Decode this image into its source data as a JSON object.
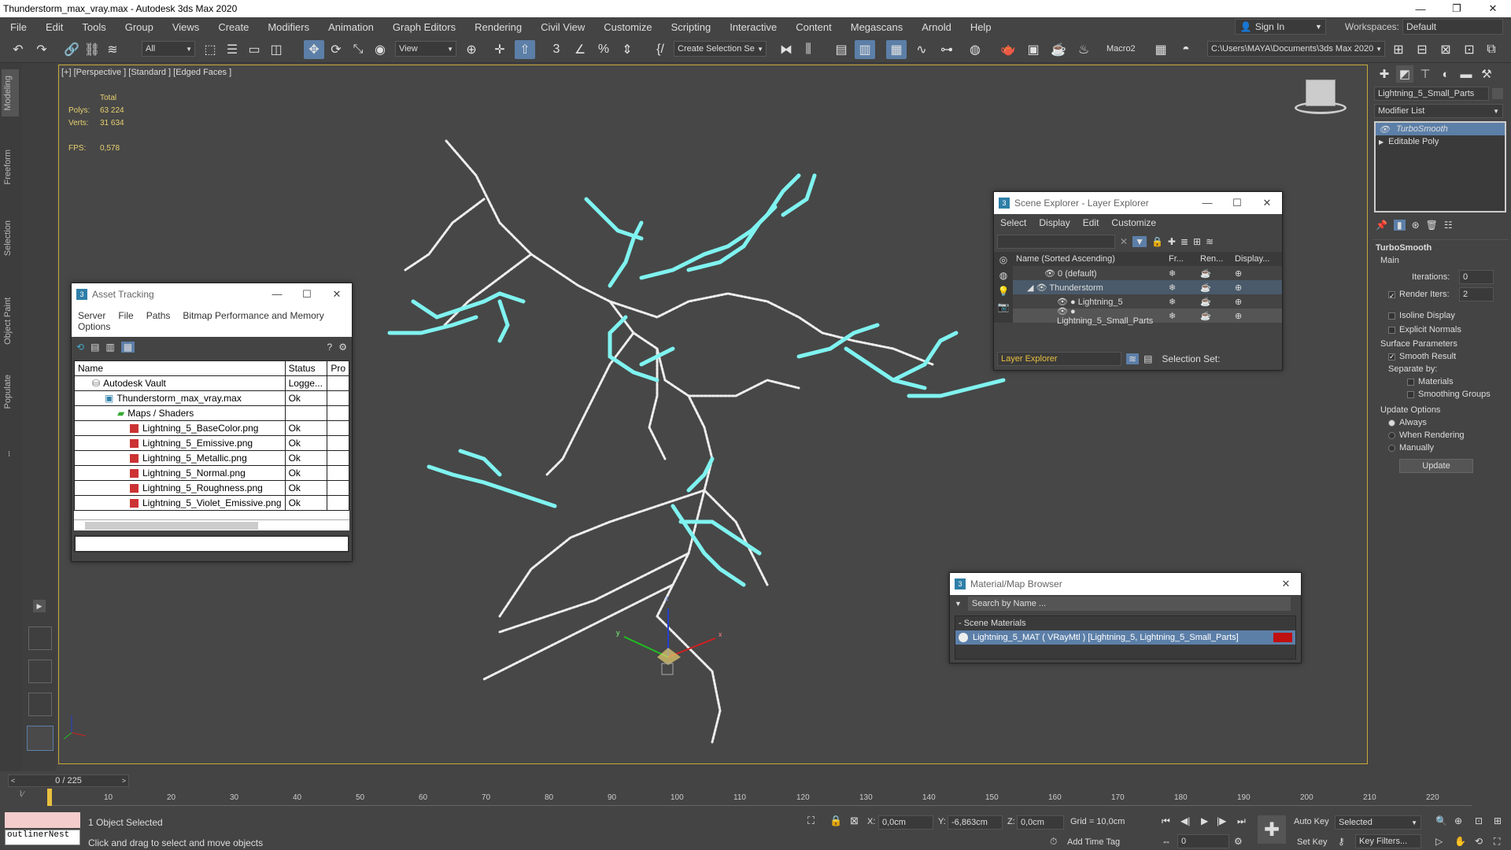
{
  "window": {
    "title": "Thunderstorm_max_vray.max - Autodesk 3ds Max 2020",
    "controls": [
      "—",
      "❐",
      "✕"
    ]
  },
  "menu": {
    "items": [
      "File",
      "Edit",
      "Tools",
      "Group",
      "Views",
      "Create",
      "Modifiers",
      "Animation",
      "Graph Editors",
      "Rendering",
      "Civil View",
      "Customize",
      "Scripting",
      "Interactive",
      "Content",
      "Megascans",
      "Arnold",
      "Help"
    ],
    "sign_in": "Sign In",
    "workspaces_label": "Workspaces:",
    "workspace_value": "Default"
  },
  "toolbar": {
    "filter_select": "All",
    "view_select": "View",
    "selection_set": "Create Selection Se",
    "macro": "Macro2",
    "path": "C:\\Users\\MAYA\\Documents\\3ds Max 2020"
  },
  "left_tabs": [
    "Modeling",
    "Freeform",
    "Selection",
    "Object Paint",
    "Populate"
  ],
  "viewport": {
    "label": "[+] [Perspective ] [Standard ] [Edged Faces ]",
    "stats": {
      "total_label": "Total",
      "polys_label": "Polys:",
      "polys_value": "63 224",
      "verts_label": "Verts:",
      "verts_value": "31 634",
      "fps_label": "FPS:",
      "fps_value": "0,578"
    },
    "gizmo_axes": [
      "x",
      "y",
      "z"
    ]
  },
  "asset_tracking": {
    "title": "Asset Tracking",
    "menu": [
      "Server",
      "File",
      "Paths",
      "Bitmap Performance and Memory"
    ],
    "menu2": "Options",
    "columns": [
      "Name",
      "Status",
      "Pro"
    ],
    "rows": [
      {
        "name": "Autodesk Vault",
        "status": "Logge..."
      },
      {
        "name": "Thunderstorm_max_vray.max",
        "status": "Ok"
      },
      {
        "name": "Maps / Shaders",
        "status": ""
      },
      {
        "name": "Lightning_5_BaseColor.png",
        "status": "Ok"
      },
      {
        "name": "Lightning_5_Emissive.png",
        "status": "Ok"
      },
      {
        "name": "Lightning_5_Metallic.png",
        "status": "Ok"
      },
      {
        "name": "Lightning_5_Normal.png",
        "status": "Ok"
      },
      {
        "name": "Lightning_5_Roughness.png",
        "status": "Ok"
      },
      {
        "name": "Lightning_5_Violet_Emissive.png",
        "status": "Ok"
      }
    ]
  },
  "scene_explorer": {
    "title": "Scene Explorer - Layer Explorer",
    "menu": [
      "Select",
      "Display",
      "Edit",
      "Customize"
    ],
    "columns": [
      "Name (Sorted Ascending)",
      "Fr...",
      "Ren...",
      "Display..."
    ],
    "rows": [
      {
        "name": "0 (default)"
      },
      {
        "name": "Thunderstorm"
      },
      {
        "name": "Lightning_5"
      },
      {
        "name": "Lightning_5_Small_Parts"
      }
    ],
    "explorer_select": "Layer Explorer",
    "selection_set_label": "Selection Set:"
  },
  "material_browser": {
    "title": "Material/Map Browser",
    "search_placeholder": "Search by Name ...",
    "group": "- Scene Materials",
    "material": "Lightning_5_MAT ( VRayMtl ) [Lightning_5, Lightning_5_Small_Parts]"
  },
  "command_panel": {
    "object_name": "Lightning_5_Small_Parts",
    "modifier_list": "Modifier List",
    "stack": [
      "TurboSmooth",
      "Editable Poly"
    ],
    "rollout_title": "TurboSmooth",
    "main_label": "Main",
    "iterations_label": "Iterations:",
    "iterations_value": "0",
    "render_iters_label": "Render Iters:",
    "render_iters_value": "2",
    "isoline": "Isoline Display",
    "explicit": "Explicit Normals",
    "surface_params": "Surface Parameters",
    "smooth_result": "Smooth Result",
    "separate_by": "Separate by:",
    "materials": "Materials",
    "smoothing_groups": "Smoothing Groups",
    "update_options": "Update Options",
    "always": "Always",
    "when_rendering": "When Rendering",
    "manually": "Manually",
    "update_btn": "Update"
  },
  "timeline": {
    "frame_counter": "0 / 225",
    "ticks": [
      "10",
      "20",
      "30",
      "40",
      "50",
      "60",
      "70",
      "80",
      "90",
      "100",
      "110",
      "120",
      "130",
      "140",
      "150",
      "160",
      "170",
      "180",
      "190",
      "200",
      "210",
      "220"
    ]
  },
  "status_bar": {
    "script_box": "outlinerNest",
    "selected": "1 Object Selected",
    "hint": "Click and drag to select and move objects",
    "x_label": "X:",
    "x_value": "0,0cm",
    "y_label": "Y:",
    "y_value": "-6,863cm",
    "z_label": "Z:",
    "z_value": "0,0cm",
    "grid": "Grid = 10,0cm",
    "add_time_tag": "Add Time Tag",
    "auto_key": "Auto Key",
    "selected_select": "Selected",
    "set_key": "Set Key",
    "key_filters": "Key Filters...",
    "frame_field": "0"
  },
  "colors": {
    "lightning": "#7ff3f0",
    "accent": "#5c7fa8",
    "viewport_border": "#c9a93a"
  }
}
